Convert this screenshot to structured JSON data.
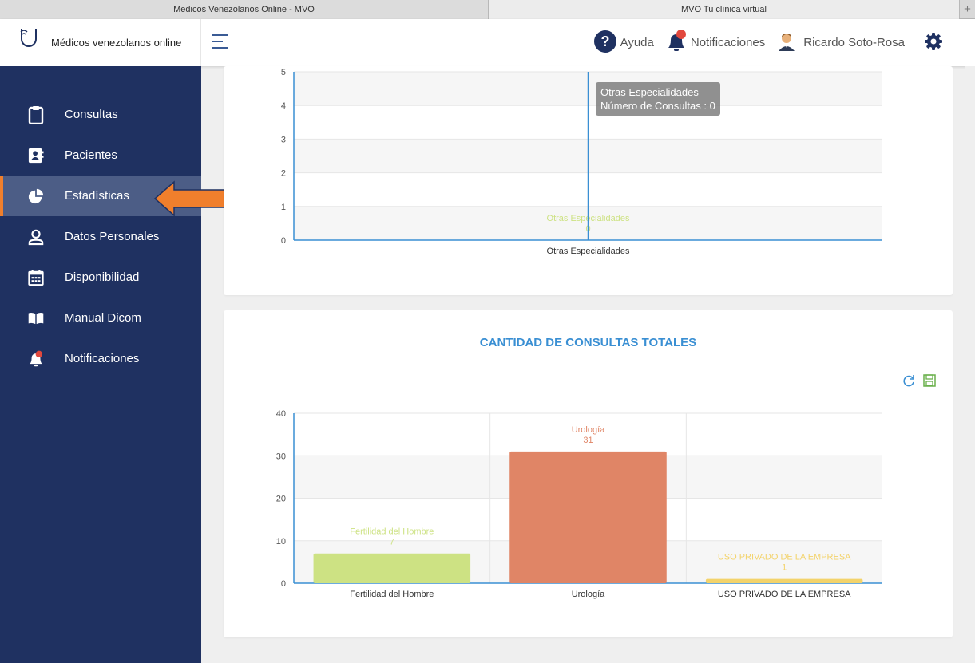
{
  "browser": {
    "tabs": [
      "Medicos Venezolanos Online - MVO",
      "MVO Tu clínica virtual"
    ],
    "new_tab": "+"
  },
  "header": {
    "brand": "Médicos venezolanos online",
    "help": "Ayuda",
    "notifications": "Notificaciones",
    "user": "Ricardo Soto-Rosa"
  },
  "sidebar": {
    "items": [
      {
        "label": "Consultas",
        "icon": "clipboard-icon"
      },
      {
        "label": "Pacientes",
        "icon": "contact-book-icon"
      },
      {
        "label": "Estadísticas",
        "icon": "pie-chart-icon",
        "active": true
      },
      {
        "label": "Datos Personales",
        "icon": "user-icon"
      },
      {
        "label": "Disponibilidad",
        "icon": "calendar-icon"
      },
      {
        "label": "Manual Dicom",
        "icon": "book-icon"
      },
      {
        "label": "Notificaciones",
        "icon": "bell-icon"
      }
    ]
  },
  "colors": {
    "sidebar_bg": "#1f3161",
    "active_item": "#4c5d86",
    "accent_orange": "#f07f2c",
    "title_blue": "#3a8fd3"
  },
  "chart1": {
    "tooltip_title": "Otras Especialidades",
    "tooltip_value": "Número de Consultas : 0"
  },
  "chart_data": [
    {
      "type": "bar",
      "title": "",
      "categories": [
        "Otras Especialidades"
      ],
      "values": [
        0
      ],
      "data_labels": [
        "Otras Especialidades"
      ],
      "ylim": [
        0,
        5
      ],
      "yticks": [
        0,
        1,
        2,
        3,
        4,
        5
      ],
      "grid": true,
      "colors": [
        "#cde283"
      ]
    },
    {
      "type": "bar",
      "title": "CANTIDAD DE CONSULTAS TOTALES",
      "categories": [
        "Fertilidad del Hombre",
        "Urología",
        "USO PRIVADO DE LA EMPRESA"
      ],
      "values": [
        7,
        31,
        1
      ],
      "data_labels": [
        "Fertilidad del Hombre",
        "Urología",
        "USO PRIVADO DE LA EMPRESA"
      ],
      "ylim": [
        0,
        40
      ],
      "yticks": [
        0,
        10,
        20,
        30,
        40
      ],
      "grid": true,
      "colors": [
        "#cde283",
        "#e08566",
        "#f3d36b"
      ]
    }
  ]
}
